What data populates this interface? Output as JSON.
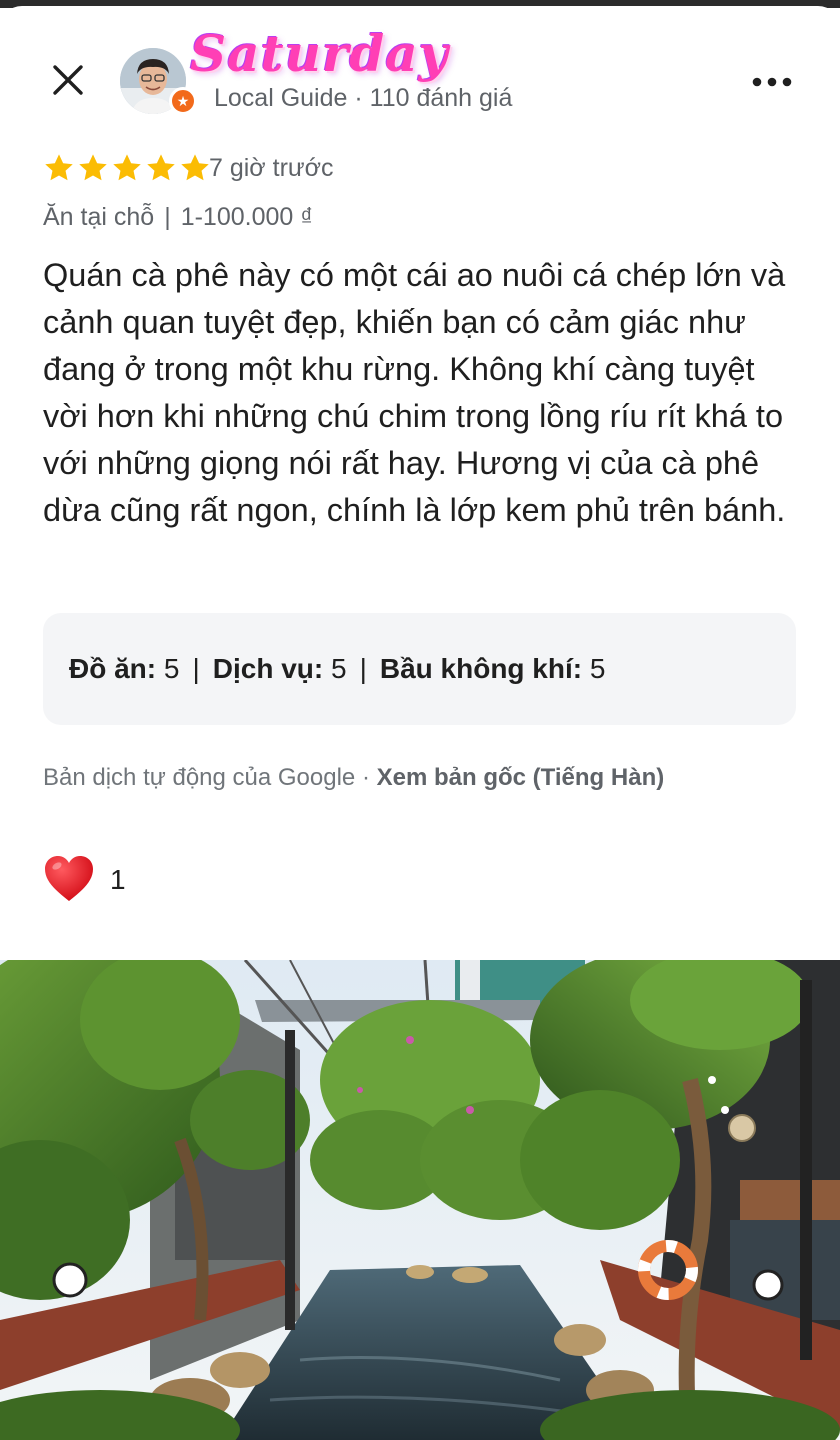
{
  "reviewer": {
    "name": "Saturday",
    "meta": "Local Guide · 110 đánh giá"
  },
  "review": {
    "rating": 5,
    "max_rating": 5,
    "time": "7 giờ trước",
    "dining_mode": "Ăn tại chỗ",
    "price_range": "1-100.000 ₫",
    "text": "Quán cà phê này có một cái ao nuôi cá chép lớn và cảnh quan tuyệt đẹp, khiến bạn có cảm giác như đang ở trong một khu rừng. Không khí càng tuyệt vời hơn khi những chú chim trong lồng ríu rít khá to với những giọng nói rất hay. Hương vị của cà phê dừa cũng rất ngon, chính là lớp kem phủ trên bánh."
  },
  "sub_ratings": {
    "food_label": "Đồ ăn:",
    "food_value": "5",
    "service_label": "Dịch vụ:",
    "service_value": "5",
    "atmosphere_label": "Bầu không khí:",
    "atmosphere_value": "5"
  },
  "translation": {
    "note": "Bản dịch tự động của Google ·",
    "link": "Xem bản gốc (Tiếng Hàn)"
  },
  "likes": {
    "count": "1"
  },
  "icons": {
    "close": "close-icon",
    "more": "more-horiz-icon",
    "star": "star-icon",
    "heart": "heart-icon",
    "guide_badge": "local-guide-star-icon"
  },
  "colors": {
    "star": "#fbbc04",
    "heart": "#e8141c",
    "badge": "#f26a1b",
    "name_pink": "#ff3fb5"
  }
}
